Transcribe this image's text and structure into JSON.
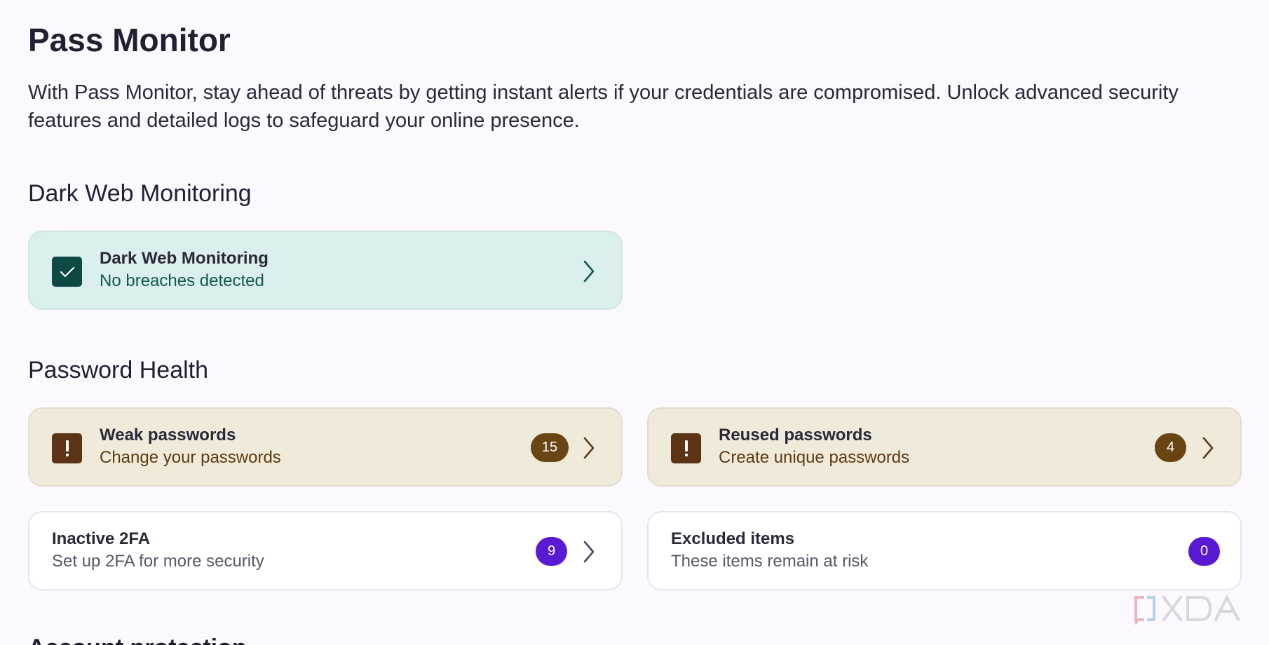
{
  "page": {
    "title": "Pass Monitor",
    "description": "With Pass Monitor, stay ahead of threats by getting instant alerts if your credentials are compromised. Unlock advanced security features and detailed logs to safeguard your online presence."
  },
  "dark_web": {
    "section_title": "Dark Web Monitoring",
    "card": {
      "title": "Dark Web Monitoring",
      "subtitle": "No breaches detected",
      "icon": "check-icon",
      "color": "#0e4a43"
    }
  },
  "password_health": {
    "section_title": "Password Health",
    "cards": [
      {
        "title": "Weak passwords",
        "subtitle": "Change your passwords",
        "count": "15",
        "icon": "alert-icon",
        "color": "#5c3415"
      },
      {
        "title": "Reused passwords",
        "subtitle": "Create unique passwords",
        "count": "4",
        "icon": "alert-icon",
        "color": "#5c3415"
      },
      {
        "title": "Inactive 2FA",
        "subtitle": "Set up 2FA for more security",
        "count": "9",
        "color": "#5a19d2"
      },
      {
        "title": "Excluded items",
        "subtitle": "These items remain at risk",
        "count": "0",
        "color": "#5a19d2"
      }
    ]
  },
  "next_section": {
    "title_partial": "Account protection"
  },
  "watermark": {
    "text": "XDA"
  }
}
